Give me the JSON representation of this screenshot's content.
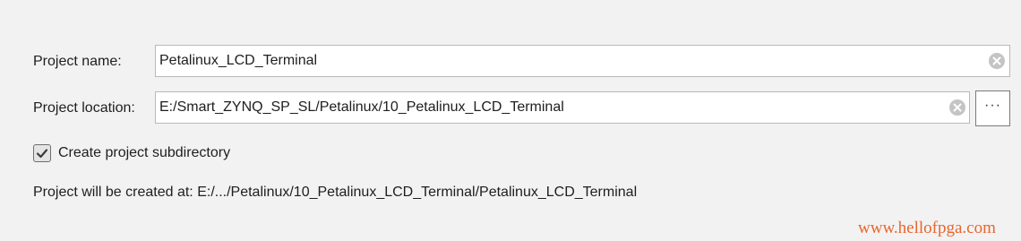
{
  "project_name": {
    "label": "Project name:",
    "value": "Petalinux_LCD_Terminal"
  },
  "project_location": {
    "label": "Project location:",
    "value": "E:/Smart_ZYNQ_SP_SL/Petalinux/10_Petalinux_LCD_Terminal",
    "browse_label": "···"
  },
  "subdirectory": {
    "label": "Create project subdirectory",
    "checked": true
  },
  "info": {
    "created_at": "Project will be created at: E:/.../Petalinux/10_Petalinux_LCD_Terminal/Petalinux_LCD_Terminal"
  },
  "watermark": "www.hellofpga.com",
  "icons": {
    "clear": "clear-icon",
    "check": "check-icon"
  },
  "colors": {
    "background": "#f2f2f2",
    "field_border": "#b9b9b9",
    "watermark": "#e8662e"
  }
}
